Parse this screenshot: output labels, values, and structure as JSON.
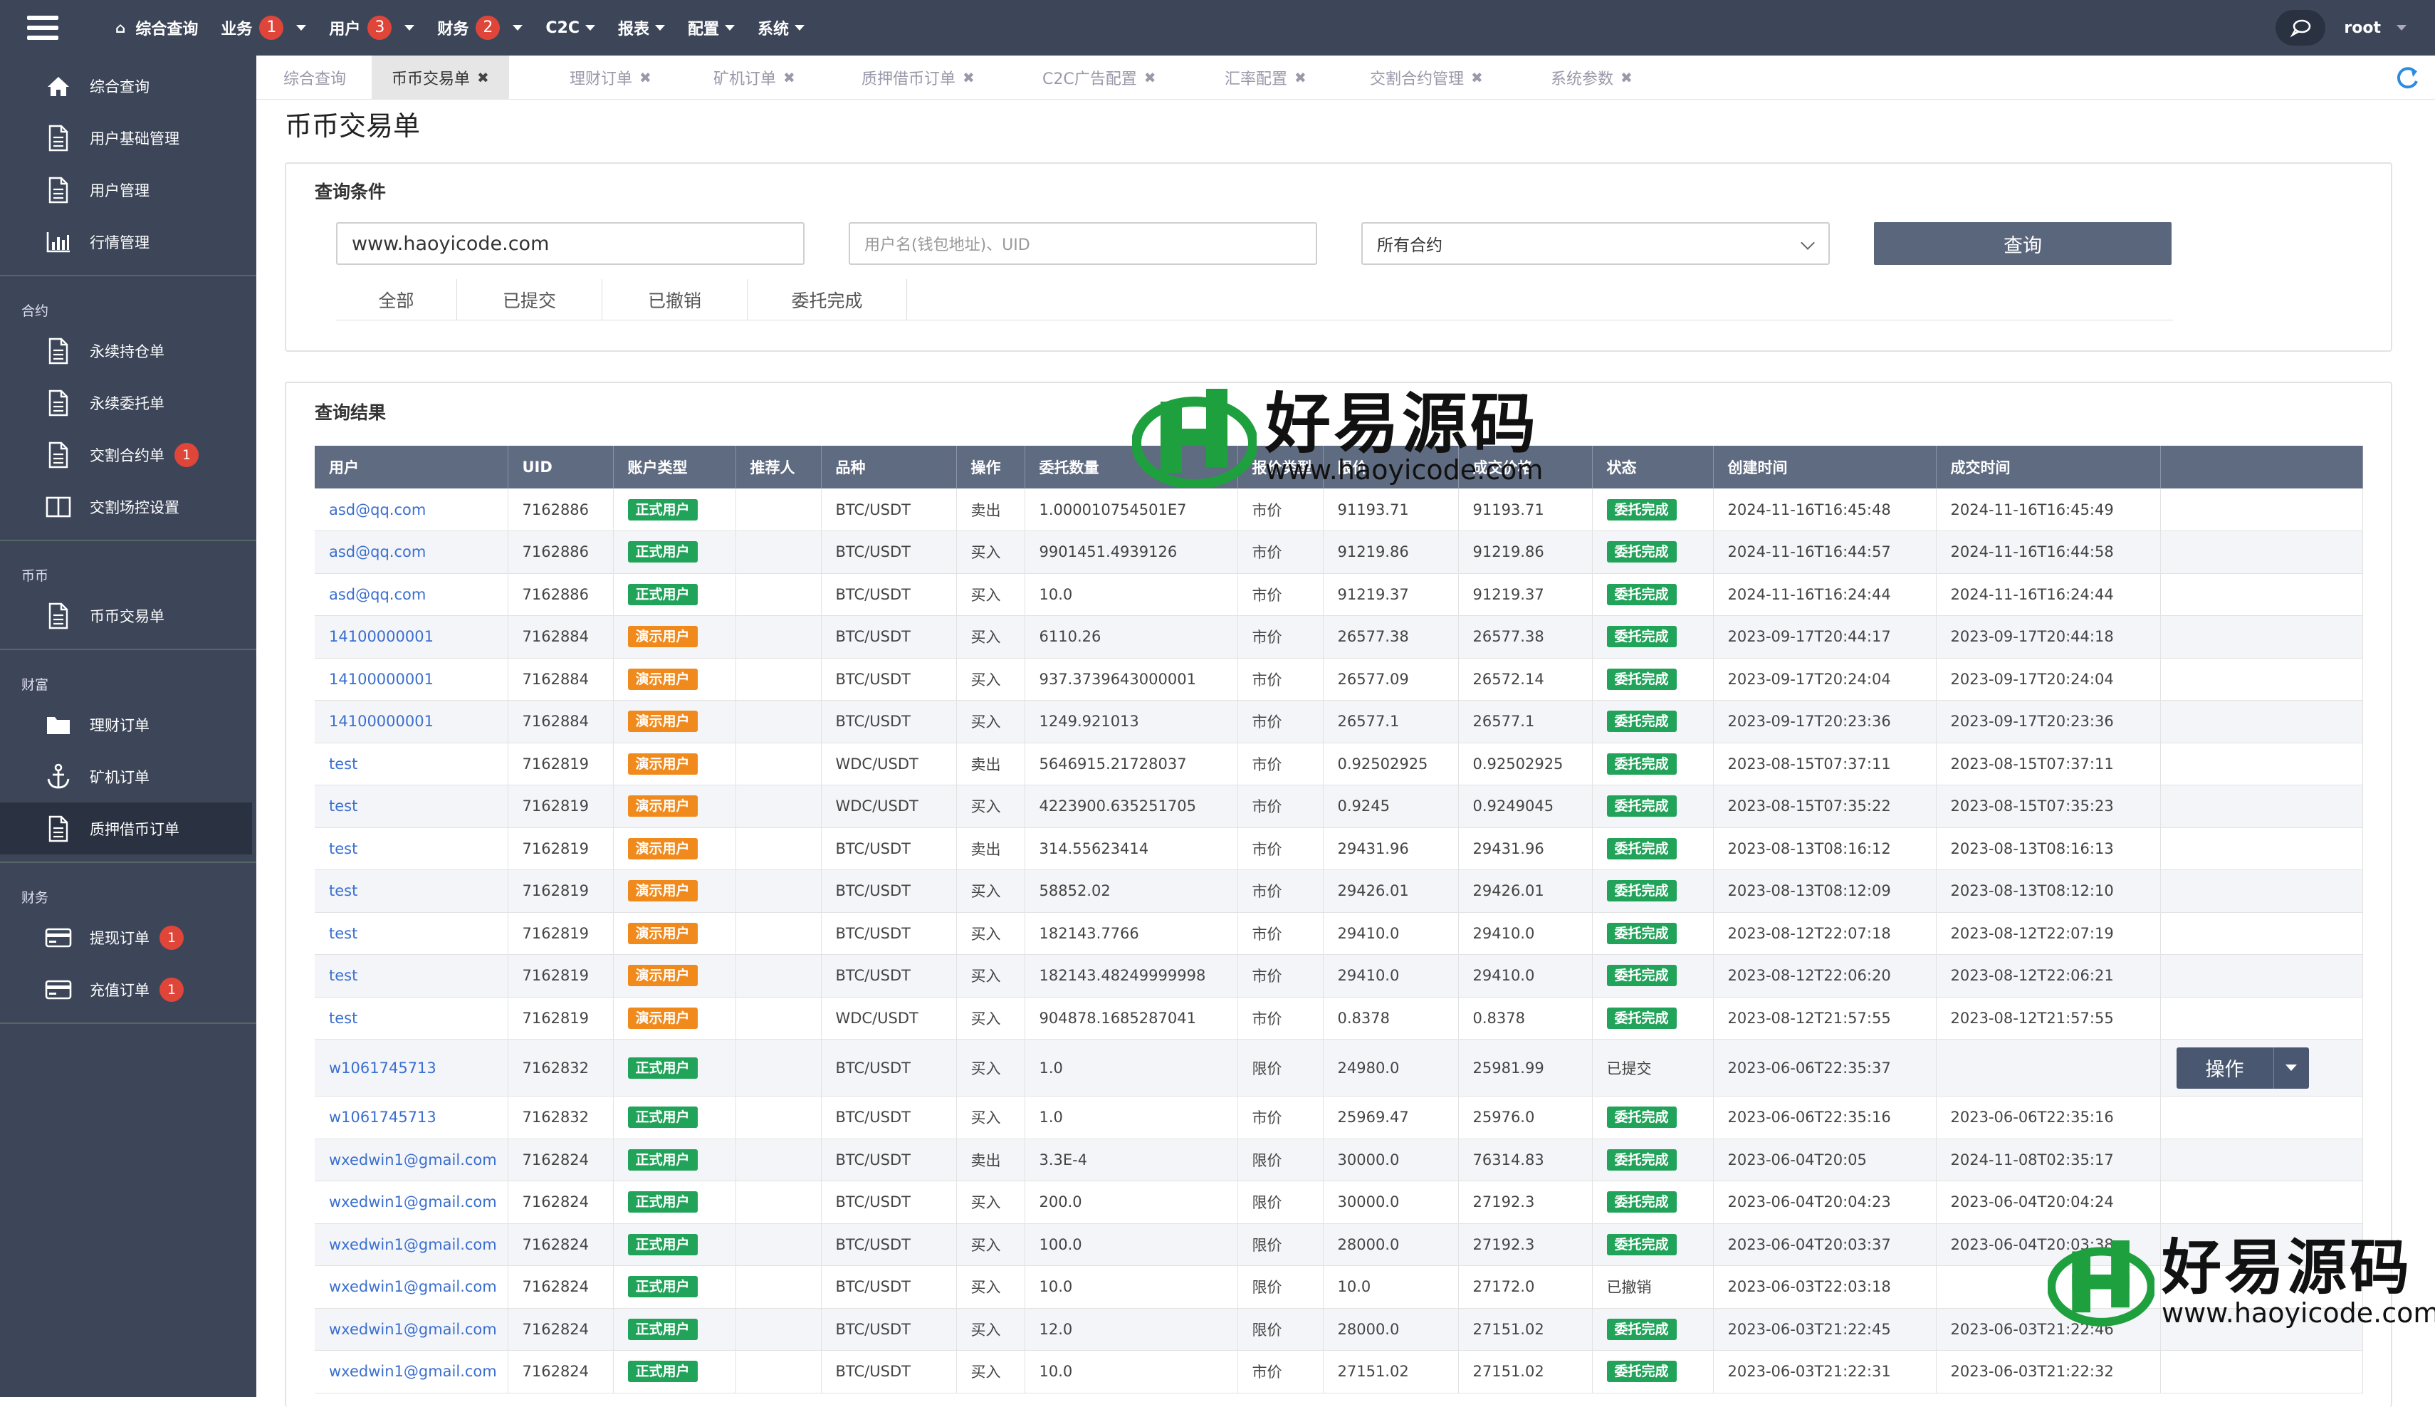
{
  "topnav": {
    "items": [
      {
        "label": "综合查询"
      },
      {
        "label": "业务",
        "badge": "1"
      },
      {
        "label": "用户",
        "badge": "3"
      },
      {
        "label": "财务",
        "badge": "2"
      },
      {
        "label": "C2C"
      },
      {
        "label": "报表"
      },
      {
        "label": "配置"
      },
      {
        "label": "系统"
      }
    ],
    "user": "root"
  },
  "sidebar": {
    "group0": [
      {
        "label": "综合查询",
        "icon": "home-icon"
      },
      {
        "label": "用户基础管理",
        "icon": "document-icon"
      },
      {
        "label": "用户管理",
        "icon": "document-icon"
      },
      {
        "label": "行情管理",
        "icon": "bar-chart-icon"
      }
    ],
    "sec1": "合约",
    "group1": [
      {
        "label": "永续持仓单",
        "icon": "document-icon"
      },
      {
        "label": "永续委托单",
        "icon": "document-icon"
      },
      {
        "label": "交割合约单",
        "icon": "document-icon",
        "badge": "1"
      },
      {
        "label": "交割场控设置",
        "icon": "columns-icon"
      }
    ],
    "sec2": "币币",
    "group2": [
      {
        "label": "币币交易单",
        "icon": "document-icon"
      }
    ],
    "sec3": "财富",
    "group3": [
      {
        "label": "理财订单",
        "icon": "folder-icon"
      },
      {
        "label": "矿机订单",
        "icon": "anchor-icon"
      },
      {
        "label": "质押借币订单",
        "icon": "document-icon"
      }
    ],
    "sec4": "财务",
    "group4": [
      {
        "label": "提现订单",
        "icon": "card-icon",
        "badge": "1"
      },
      {
        "label": "充值订单",
        "icon": "card-icon",
        "badge": "1"
      }
    ]
  },
  "tabs": [
    "综合查询",
    "币币交易单",
    "理财订单",
    "矿机订单",
    "质押借币订单",
    "C2C广告配置",
    "汇率配置",
    "交割合约管理",
    "系统参数"
  ],
  "page_title": "币币交易单",
  "query": {
    "title": "查询条件",
    "url_value": "www.haoyicode.com",
    "user_placeholder": "用户名(钱包地址)、UID",
    "contract_select": "所有合约",
    "button": "查询",
    "status_tabs": [
      "全部",
      "已提交",
      "已撤销",
      "委托完成"
    ]
  },
  "results": {
    "title": "查询结果",
    "columns": [
      "用户",
      "UID",
      "账户类型",
      "推荐人",
      "品种",
      "操作",
      "委托数量",
      "报价类型",
      "限价",
      "成交价格",
      "状态",
      "创建时间",
      "成交时间",
      ""
    ],
    "op_button": "操作",
    "rows": [
      [
        "asd@qq.com",
        "7162886",
        "正式用户",
        "",
        "BTC/USDT",
        "卖出",
        "1.000010754501E7",
        "市价",
        "91193.71",
        "91193.71",
        "委托完成",
        "2024-11-16T16:45:48",
        "2024-11-16T16:45:49"
      ],
      [
        "asd@qq.com",
        "7162886",
        "正式用户",
        "",
        "BTC/USDT",
        "买入",
        "9901451.4939126",
        "市价",
        "91219.86",
        "91219.86",
        "委托完成",
        "2024-11-16T16:44:57",
        "2024-11-16T16:44:58"
      ],
      [
        "asd@qq.com",
        "7162886",
        "正式用户",
        "",
        "BTC/USDT",
        "买入",
        "10.0",
        "市价",
        "91219.37",
        "91219.37",
        "委托完成",
        "2024-11-16T16:24:44",
        "2024-11-16T16:24:44"
      ],
      [
        "14100000001",
        "7162884",
        "演示用户",
        "",
        "BTC/USDT",
        "买入",
        "6110.26",
        "市价",
        "26577.38",
        "26577.38",
        "委托完成",
        "2023-09-17T20:44:17",
        "2023-09-17T20:44:18"
      ],
      [
        "14100000001",
        "7162884",
        "演示用户",
        "",
        "BTC/USDT",
        "买入",
        "937.3739643000001",
        "市价",
        "26577.09",
        "26572.14",
        "委托完成",
        "2023-09-17T20:24:04",
        "2023-09-17T20:24:04"
      ],
      [
        "14100000001",
        "7162884",
        "演示用户",
        "",
        "BTC/USDT",
        "买入",
        "1249.921013",
        "市价",
        "26577.1",
        "26577.1",
        "委托完成",
        "2023-09-17T20:23:36",
        "2023-09-17T20:23:36"
      ],
      [
        "test",
        "7162819",
        "演示用户",
        "",
        "WDC/USDT",
        "卖出",
        "5646915.21728037",
        "市价",
        "0.92502925",
        "0.92502925",
        "委托完成",
        "2023-08-15T07:37:11",
        "2023-08-15T07:37:11"
      ],
      [
        "test",
        "7162819",
        "演示用户",
        "",
        "WDC/USDT",
        "买入",
        "4223900.635251705",
        "市价",
        "0.9245",
        "0.9249045",
        "委托完成",
        "2023-08-15T07:35:22",
        "2023-08-15T07:35:23"
      ],
      [
        "test",
        "7162819",
        "演示用户",
        "",
        "BTC/USDT",
        "卖出",
        "314.55623414",
        "市价",
        "29431.96",
        "29431.96",
        "委托完成",
        "2023-08-13T08:16:12",
        "2023-08-13T08:16:13"
      ],
      [
        "test",
        "7162819",
        "演示用户",
        "",
        "BTC/USDT",
        "买入",
        "58852.02",
        "市价",
        "29426.01",
        "29426.01",
        "委托完成",
        "2023-08-13T08:12:09",
        "2023-08-13T08:12:10"
      ],
      [
        "test",
        "7162819",
        "演示用户",
        "",
        "BTC/USDT",
        "买入",
        "182143.7766",
        "市价",
        "29410.0",
        "29410.0",
        "委托完成",
        "2023-08-12T22:07:18",
        "2023-08-12T22:07:19"
      ],
      [
        "test",
        "7162819",
        "演示用户",
        "",
        "BTC/USDT",
        "买入",
        "182143.48249999998",
        "市价",
        "29410.0",
        "29410.0",
        "委托完成",
        "2023-08-12T22:06:20",
        "2023-08-12T22:06:21"
      ],
      [
        "test",
        "7162819",
        "演示用户",
        "",
        "WDC/USDT",
        "买入",
        "904878.1685287041",
        "市价",
        "0.8378",
        "0.8378",
        "委托完成",
        "2023-08-12T21:57:55",
        "2023-08-12T21:57:55"
      ],
      [
        "w1061745713",
        "7162832",
        "正式用户",
        "",
        "BTC/USDT",
        "买入",
        "1.0",
        "限价",
        "24980.0",
        "25981.99",
        "已提交",
        "2023-06-06T22:35:37",
        ""
      ],
      [
        "w1061745713",
        "7162832",
        "正式用户",
        "",
        "BTC/USDT",
        "买入",
        "1.0",
        "市价",
        "25969.47",
        "25976.0",
        "委托完成",
        "2023-06-06T22:35:16",
        "2023-06-06T22:35:16"
      ],
      [
        "wxedwin1@gmail.com",
        "7162824",
        "正式用户",
        "",
        "BTC/USDT",
        "卖出",
        "3.3E-4",
        "限价",
        "30000.0",
        "76314.83",
        "委托完成",
        "2023-06-04T20:05",
        "2024-11-08T02:35:17"
      ],
      [
        "wxedwin1@gmail.com",
        "7162824",
        "正式用户",
        "",
        "BTC/USDT",
        "买入",
        "200.0",
        "限价",
        "30000.0",
        "27192.3",
        "委托完成",
        "2023-06-04T20:04:23",
        "2023-06-04T20:04:24"
      ],
      [
        "wxedwin1@gmail.com",
        "7162824",
        "正式用户",
        "",
        "BTC/USDT",
        "买入",
        "100.0",
        "限价",
        "28000.0",
        "27192.3",
        "委托完成",
        "2023-06-04T20:03:37",
        "2023-06-04T20:03:38"
      ],
      [
        "wxedwin1@gmail.com",
        "7162824",
        "正式用户",
        "",
        "BTC/USDT",
        "买入",
        "10.0",
        "限价",
        "10.0",
        "27172.0",
        "已撤销",
        "2023-06-03T22:03:18",
        ""
      ],
      [
        "wxedwin1@gmail.com",
        "7162824",
        "正式用户",
        "",
        "BTC/USDT",
        "买入",
        "12.0",
        "限价",
        "28000.0",
        "27151.02",
        "委托完成",
        "2023-06-03T21:22:45",
        "2023-06-03T21:22:46"
      ],
      [
        "wxedwin1@gmail.com",
        "7162824",
        "正式用户",
        "",
        "BTC/USDT",
        "买入",
        "10.0",
        "市价",
        "27151.02",
        "27151.02",
        "委托完成",
        "2023-06-03T21:22:31",
        "2023-06-03T21:22:32"
      ]
    ]
  },
  "watermark": {
    "name": "好易源码",
    "url": "www.haoyicode.com"
  },
  "colors": {
    "sidebar": "#3d4658",
    "header": "#5f6b81",
    "green": "#22a35a",
    "orange": "#f08a1c",
    "badge": "#e0453a",
    "link": "#3a6fd0"
  }
}
